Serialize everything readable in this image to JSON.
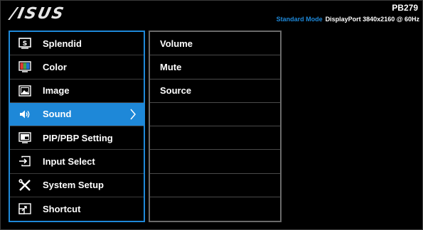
{
  "header": {
    "brand": "/ISUS",
    "model": "PB279",
    "mode_label": "Standard Mode",
    "signal_info": "DisplayPort  3840x2160 @ 60Hz"
  },
  "colors": {
    "accent": "#1e88d8",
    "background": "#000000",
    "text": "#ffffff"
  },
  "main_menu": {
    "items": [
      {
        "label": "Splendid",
        "icon": "splendid-icon",
        "active": false
      },
      {
        "label": "Color",
        "icon": "color-icon",
        "active": false
      },
      {
        "label": "Image",
        "icon": "image-icon",
        "active": false
      },
      {
        "label": "Sound",
        "icon": "speaker-icon",
        "active": true
      },
      {
        "label": "PIP/PBP Setting",
        "icon": "pip-icon",
        "active": false
      },
      {
        "label": "Input Select",
        "icon": "input-icon",
        "active": false
      },
      {
        "label": "System Setup",
        "icon": "tools-icon",
        "active": false
      },
      {
        "label": "Shortcut",
        "icon": "shortcut-icon",
        "active": false
      }
    ]
  },
  "sub_menu": {
    "items": [
      {
        "label": "Volume"
      },
      {
        "label": "Mute"
      },
      {
        "label": "Source"
      },
      {
        "label": ""
      },
      {
        "label": ""
      },
      {
        "label": ""
      },
      {
        "label": ""
      },
      {
        "label": ""
      }
    ]
  }
}
